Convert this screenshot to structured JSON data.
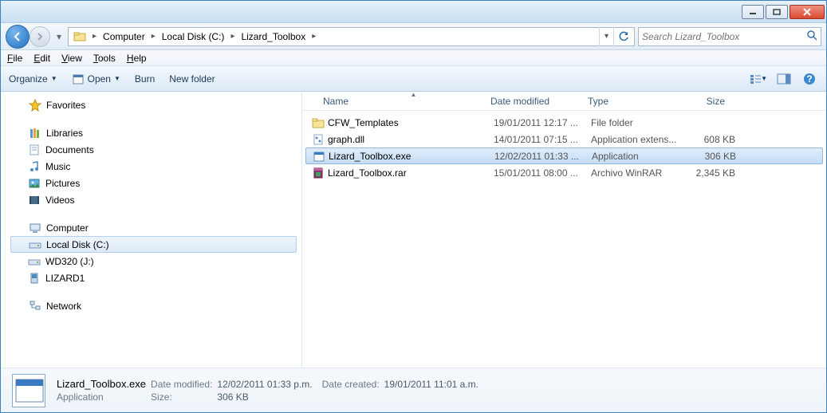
{
  "breadcrumb": [
    "Computer",
    "Local Disk (C:)",
    "Lizard_Toolbox"
  ],
  "search": {
    "placeholder": "Search Lizard_Toolbox"
  },
  "menus": {
    "file": "File",
    "edit": "Edit",
    "view": "View",
    "tools": "Tools",
    "help": "Help"
  },
  "toolbar": {
    "organize": "Organize",
    "open": "Open",
    "burn": "Burn",
    "newfolder": "New folder"
  },
  "sidebar": {
    "favorites": "Favorites",
    "libraries": "Libraries",
    "lib_items": [
      "Documents",
      "Music",
      "Pictures",
      "Videos"
    ],
    "computer": "Computer",
    "comp_items": [
      "Local Disk (C:)",
      "WD320 (J:)",
      "LIZARD1"
    ],
    "network": "Network"
  },
  "columns": {
    "name": "Name",
    "date": "Date modified",
    "type": "Type",
    "size": "Size"
  },
  "files": [
    {
      "name": "CFW_Templates",
      "date": "19/01/2011 12:17 ...",
      "type": "File folder",
      "size": "",
      "icon": "folder"
    },
    {
      "name": "graph.dll",
      "date": "14/01/2011 07:15 ...",
      "type": "Application extens...",
      "size": "608 KB",
      "icon": "dll"
    },
    {
      "name": "Lizard_Toolbox.exe",
      "date": "12/02/2011 01:33 ...",
      "type": "Application",
      "size": "306 KB",
      "icon": "exe",
      "selected": true
    },
    {
      "name": "Lizard_Toolbox.rar",
      "date": "15/01/2011 08:00 ...",
      "type": "Archivo WinRAR",
      "size": "2,345 KB",
      "icon": "rar"
    }
  ],
  "details": {
    "filename": "Lizard_Toolbox.exe",
    "date_modified_label": "Date modified:",
    "date_modified": "12/02/2011 01:33 p.m.",
    "date_created_label": "Date created:",
    "date_created": "19/01/2011 11:01 a.m.",
    "type": "Application",
    "size_label": "Size:",
    "size": "306 KB"
  }
}
